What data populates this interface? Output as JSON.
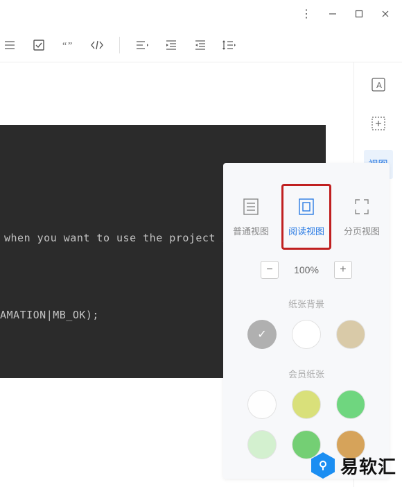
{
  "titlebar": {
    "more": "⋮",
    "min": "—",
    "max": "▢",
    "close": "✕"
  },
  "toolbar": {
    "task": "☑",
    "quote": "“”",
    "code": "</>"
  },
  "rightcol": {
    "view_label": "视图"
  },
  "code": {
    "line1": "when you want to use the project ico",
    "line2": "AMATION|MB_OK);"
  },
  "viewpanel": {
    "modes": [
      {
        "label": "普通视图"
      },
      {
        "label": "阅读视图"
      },
      {
        "label": "分页视图"
      }
    ],
    "zoom": {
      "minus": "−",
      "value": "100%",
      "plus": "+"
    },
    "section_bg": "纸张背景",
    "section_member": "会员纸张",
    "check": "✓",
    "swatches_bg": [
      {
        "color": "#b0b0b0",
        "selected": true
      },
      {
        "color": "#ffffff"
      },
      {
        "color": "#d9caa8"
      }
    ],
    "swatches_member": [
      {
        "color": "#ffffff"
      },
      {
        "color": "#d9e07a"
      },
      {
        "color": "#6fd67f"
      },
      {
        "color": "#d3f0cf"
      },
      {
        "color": "#74cf74"
      },
      {
        "color": "#d6a35a"
      }
    ]
  },
  "watermark": {
    "text": "易软汇"
  }
}
